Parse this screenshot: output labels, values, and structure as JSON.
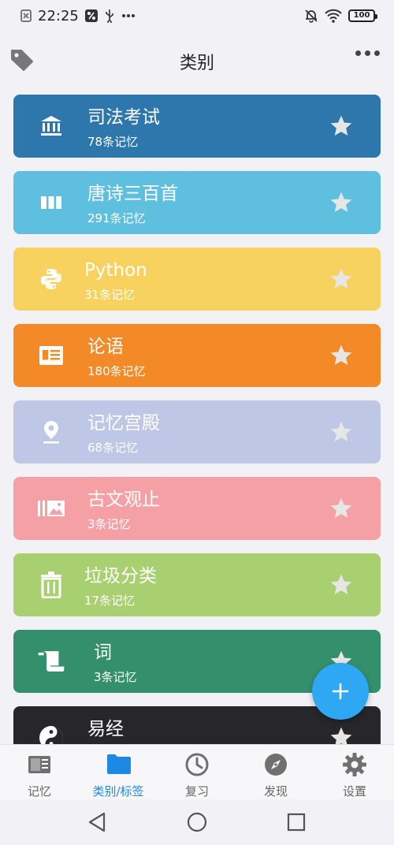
{
  "status_bar": {
    "time": "22:25",
    "battery": "100"
  },
  "header": {
    "title": "类别"
  },
  "categories": [
    {
      "name": "司法考试",
      "count": "78条记忆",
      "color": "#2e77ad",
      "icon": "bank-icon"
    },
    {
      "name": "唐诗三百首",
      "count": "291条记忆",
      "color": "#5fbfde",
      "icon": "columns-icon"
    },
    {
      "name": "Python",
      "count": "31条记忆",
      "color": "#f8d25e",
      "icon": "python-icon"
    },
    {
      "name": "论语",
      "count": "180条记忆",
      "color": "#f38a27",
      "icon": "newspaper-icon"
    },
    {
      "name": "记忆宫殿",
      "count": "68条记忆",
      "color": "#bec7e6",
      "icon": "location-icon"
    },
    {
      "name": "古文观止",
      "count": "3条记忆",
      "color": "#f4a0a5",
      "icon": "gallery-icon"
    },
    {
      "name": "垃圾分类",
      "count": "17条记忆",
      "color": "#a9d070",
      "icon": "trash-icon"
    },
    {
      "name": "词",
      "count": "3条记忆",
      "color": "#348f6d",
      "icon": "scroll-icon"
    },
    {
      "name": "易经",
      "count": "",
      "color": "#26262b",
      "icon": "yin-yang-icon"
    }
  ],
  "bottom_nav": [
    {
      "label": "记忆",
      "icon": "note-icon",
      "active": false
    },
    {
      "label": "类别/标签",
      "icon": "folder-icon",
      "active": true
    },
    {
      "label": "复习",
      "icon": "clock-icon",
      "active": false
    },
    {
      "label": "发现",
      "icon": "compass-icon",
      "active": false
    },
    {
      "label": "设置",
      "icon": "gear-icon",
      "active": false
    }
  ],
  "colors": {
    "accent": "#1e88e5",
    "fab": "#2fa8f3",
    "star": "#e6e6e6"
  }
}
